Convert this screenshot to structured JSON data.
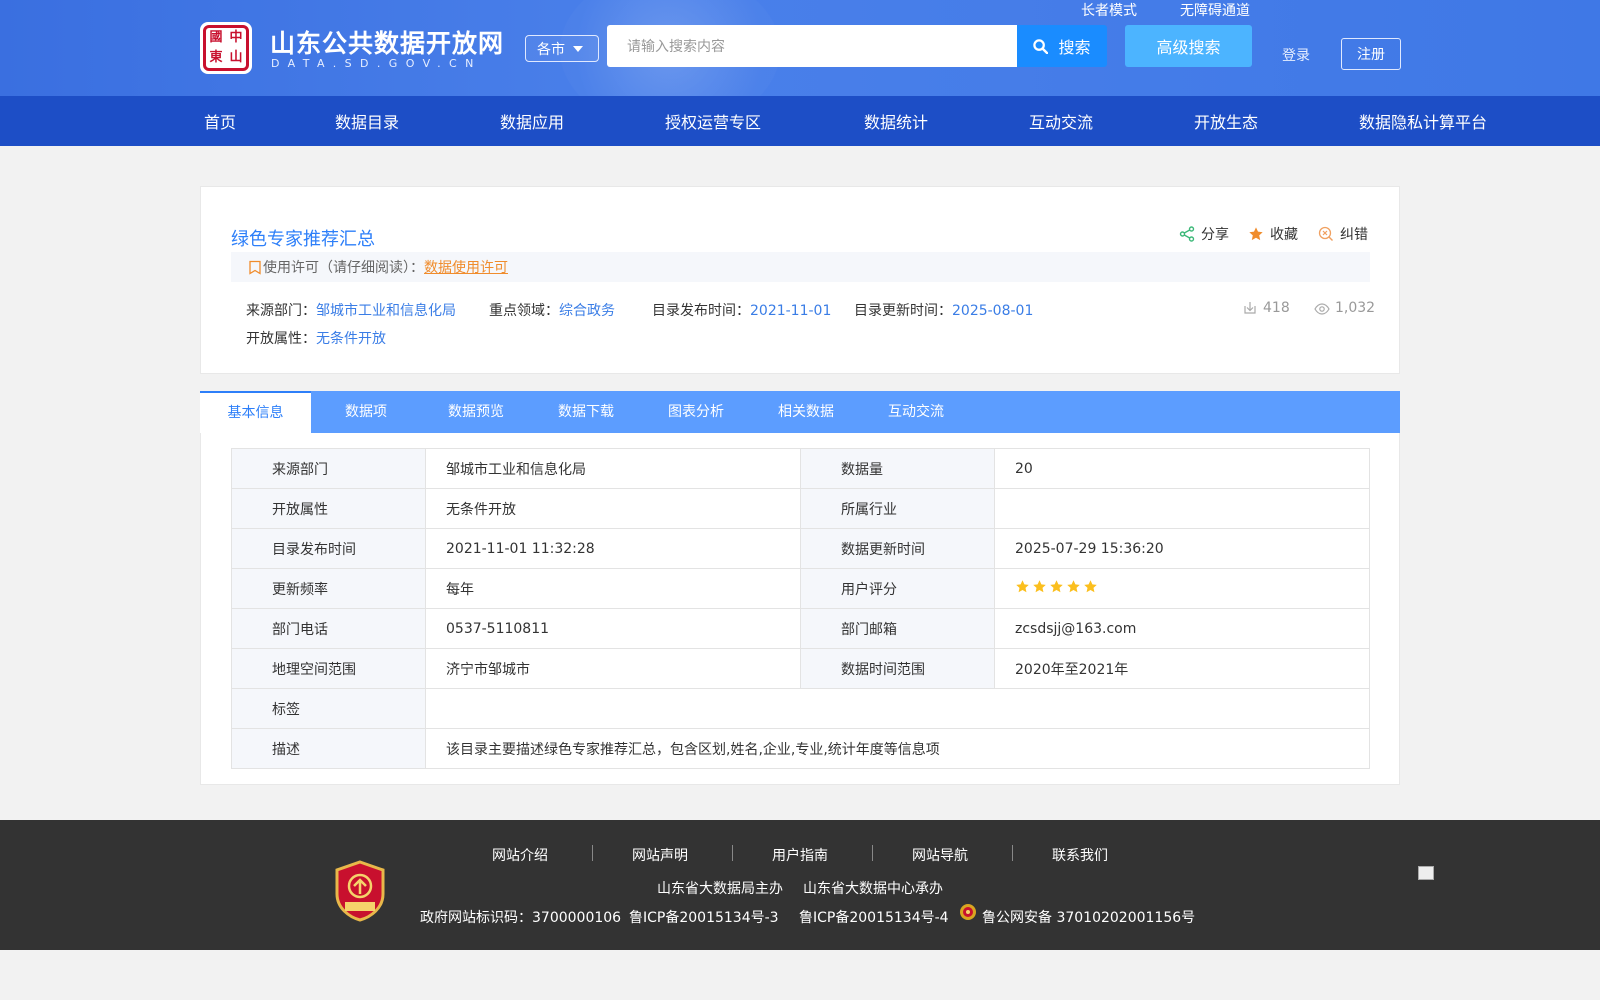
{
  "header": {
    "seal_text": [
      "中",
      "國",
      "山",
      "東"
    ],
    "site_title": "山东公共数据开放网",
    "site_domain": "DATA.SD.GOV.CN",
    "city_select": "各市",
    "search_placeholder": "请输入搜索内容",
    "search_button": "搜索",
    "advanced_search": "高级搜索",
    "elder_mode": "长者模式",
    "accessibility": "无障碍通道",
    "login": "登录",
    "register": "注册"
  },
  "nav": {
    "items": [
      "首页",
      "数据目录",
      "数据应用",
      "授权运营专区",
      "数据统计",
      "互动交流",
      "开放生态",
      "数据隐私计算平台"
    ]
  },
  "dataset": {
    "title": "绿色专家推荐汇总",
    "actions": {
      "share": "分享",
      "favorite": "收藏",
      "correct": "纠错"
    },
    "license_label": "使用许可（请仔细阅读）：",
    "license_link": "数据使用许可",
    "source_label": "来源部门：",
    "source_value": "邹城市工业和信息化局",
    "domain_label": "重点领域：",
    "domain_value": "综合政务",
    "publish_label": "目录发布时间：",
    "publish_value": "2021-11-01",
    "update_label": "目录更新时间：",
    "update_value": "2025-08-01",
    "open_label": "开放属性：",
    "open_value": "无条件开放",
    "downloads": "418",
    "views": "1,032"
  },
  "tabs": [
    "基本信息",
    "数据项",
    "数据预览",
    "数据下载",
    "图表分析",
    "相关数据",
    "互动交流"
  ],
  "info_table": {
    "rows": [
      {
        "k1": "来源部门",
        "v1": "邹城市工业和信息化局",
        "k2": "数据量",
        "v2": "20"
      },
      {
        "k1": "开放属性",
        "v1": "无条件开放",
        "k2": "所属行业",
        "v2": ""
      },
      {
        "k1": "目录发布时间",
        "v1": "2021-11-01 11:32:28",
        "k2": "数据更新时间",
        "v2": "2025-07-29 15:36:20"
      },
      {
        "k1": "更新频率",
        "v1": "每年",
        "k2": "用户评分",
        "v2": ""
      },
      {
        "k1": "部门电话",
        "v1": "0537-5110811",
        "k2": "部门邮箱",
        "v2": "zcsdsjj@163.com"
      },
      {
        "k1": "地理空间范围",
        "v1": "济宁市邹城市",
        "k2": "数据时间范围",
        "v2": "2020年至2021年"
      }
    ],
    "tags_label": "标签",
    "tags_value": "",
    "desc_label": "描述",
    "desc_value": "该目录主要描述绿色专家推荐汇总，包含区划,姓名,企业,专业,统计年度等信息项",
    "rating_stars": 5
  },
  "footer": {
    "links": [
      "网站介绍",
      "网站声明",
      "用户指南",
      "网站导航",
      "联系我们"
    ],
    "host": "山东省大数据局主办",
    "organizer": "山东省大数据中心承办",
    "gov_id": "政府网站标识码：3700000106",
    "icp1": "鲁ICP备20015134号-3",
    "icp2": "鲁ICP备20015134号-4",
    "police": "鲁公网安备 37010202001156号",
    "badge_text": "党政机关"
  },
  "colors": {
    "brand_blue": "#1d4ec6",
    "link_blue": "#2d7ff9",
    "accent_orange": "#f08c2c",
    "star": "#fbbf1e"
  }
}
